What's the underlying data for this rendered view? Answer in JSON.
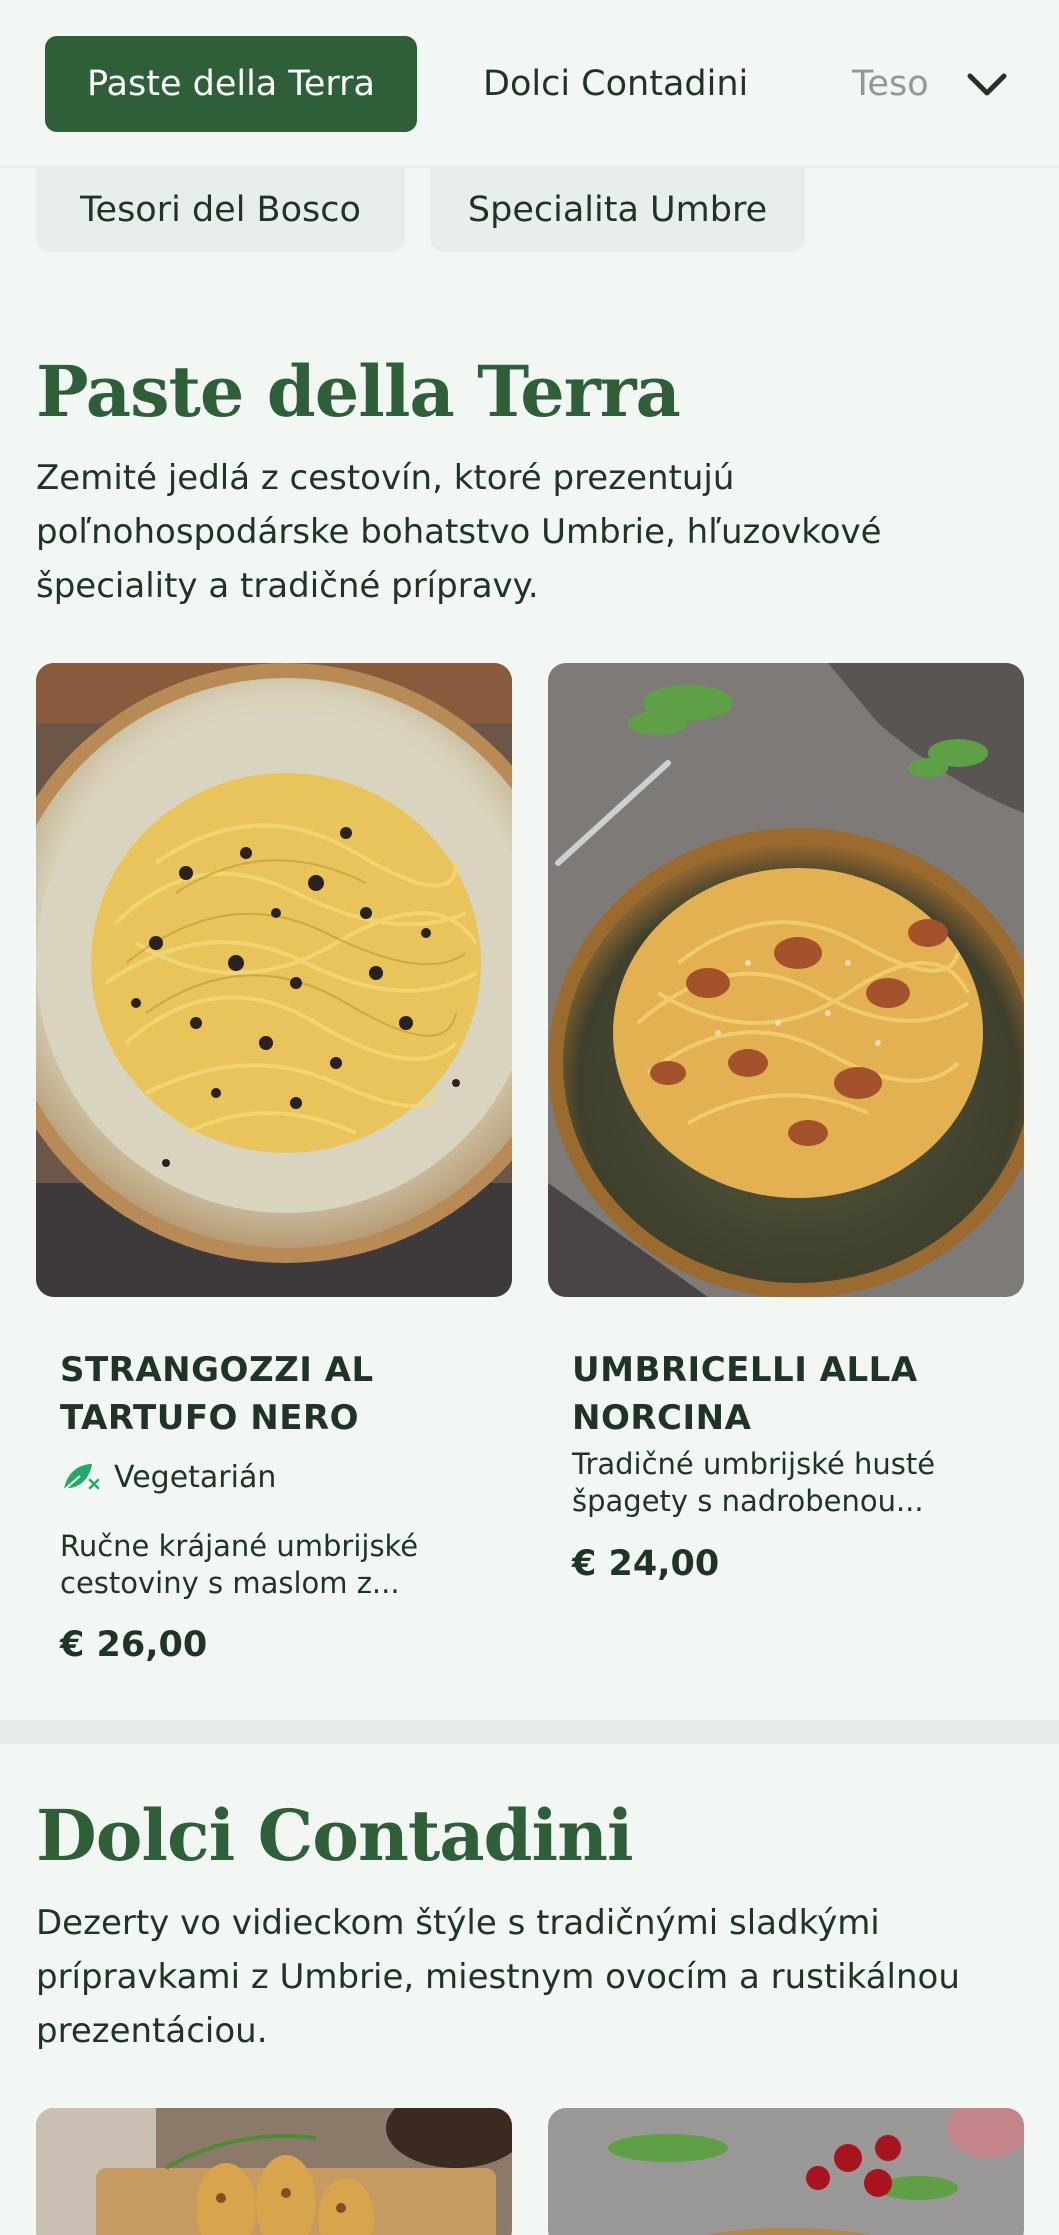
{
  "nav": {
    "tabs": [
      {
        "label": "Paste della Terra",
        "active": true
      },
      {
        "label": "Dolci Contadini",
        "active": false
      },
      {
        "label": "Tesori del Bosco",
        "active": false
      }
    ],
    "visible_faded_tab_text": "Teso",
    "more_icon": "chevron-down-icon",
    "chips": [
      "Tesori del Bosco",
      "Specialita Umbre"
    ]
  },
  "colors": {
    "accent": "#2e5f38",
    "background": "#f2f7f3",
    "veg_icon": "#22a86b"
  },
  "sections": [
    {
      "title": "Paste della Terra",
      "description": "Zemité jedlá z cestovín, ktoré prezentujú poľnohospodárske bohatstvo Umbrie, hľuzovkové špeciality a tradičné prípravy.",
      "items": [
        {
          "name": "STRANGOZZI AL TARTUFO NERO",
          "tag": "Vegetarián",
          "tag_icon": "leaf-icon",
          "description": "Ručne krájané umbrijské cestoviny s maslom z...",
          "price": "€ 26,00"
        },
        {
          "name": "UMBRICELLI ALLA NORCINA",
          "description": "Tradičné umbrijské husté špagety s nadrobenou...",
          "price": "€ 24,00"
        }
      ]
    },
    {
      "title": "Dolci Contadini",
      "description": "Dezerty vo vidieckom štýle s tradičnými sladkými prípravkami z Umbrie, miestnym ovocím a rustikálnou prezentáciou."
    }
  ]
}
